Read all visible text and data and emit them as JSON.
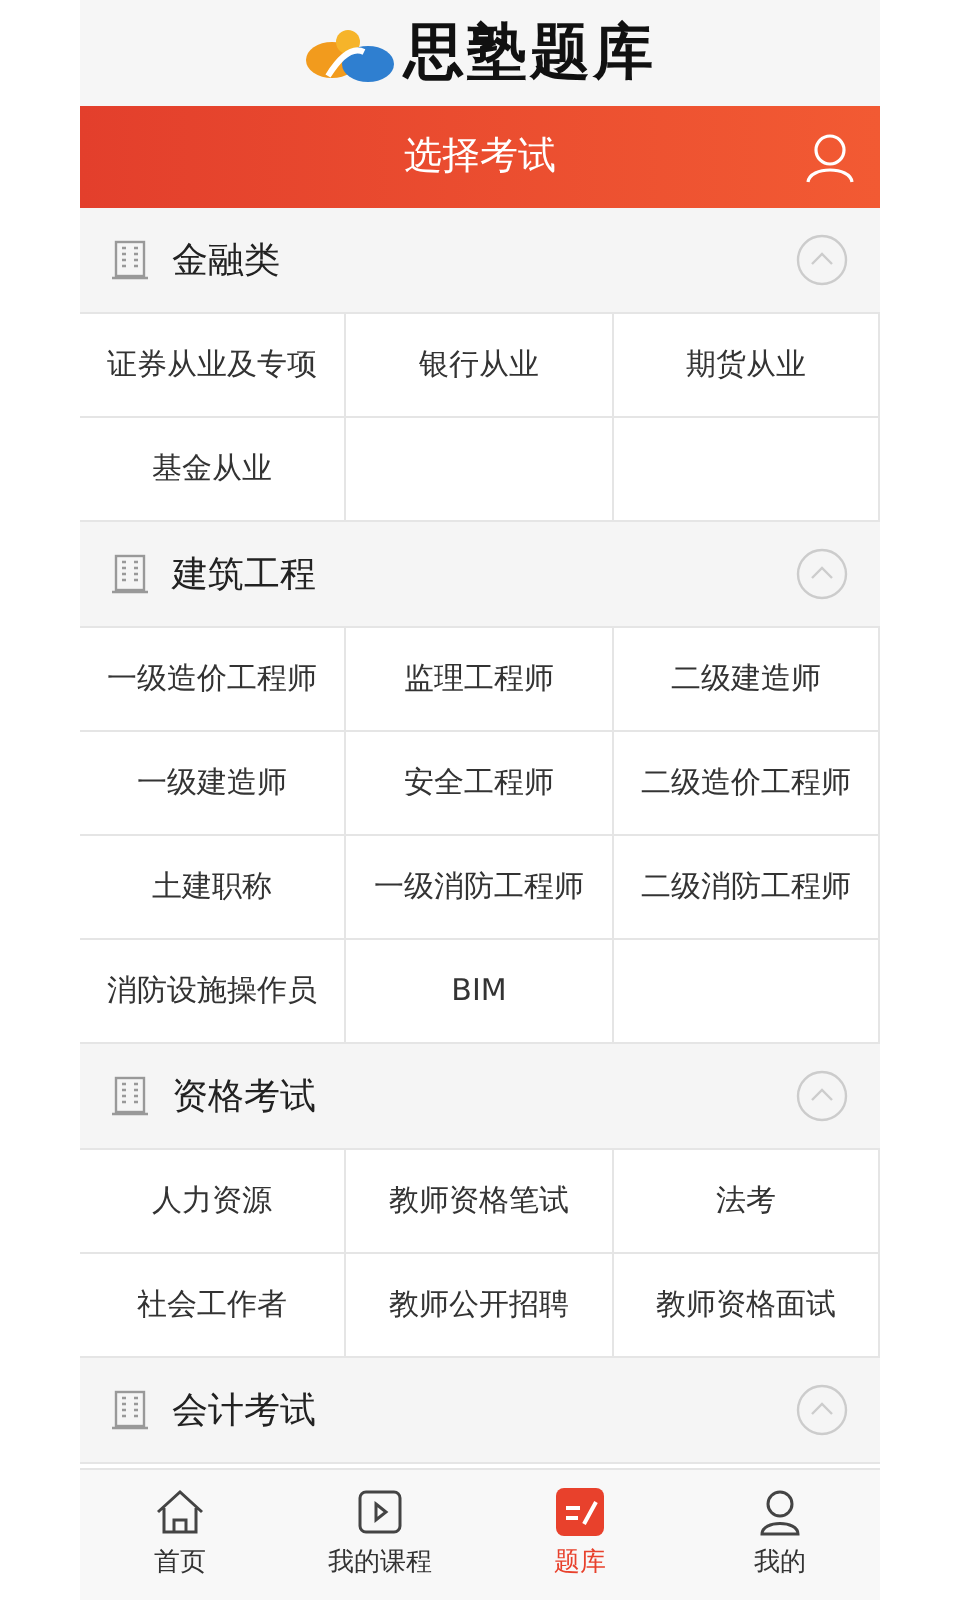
{
  "header": {
    "logo_text": "思塾题库"
  },
  "title_bar": {
    "title": "选择考试"
  },
  "sections": [
    {
      "title": "金融类",
      "expanded": true,
      "items": [
        "证券从业及专项",
        "银行从业",
        "期货从业",
        "基金从业"
      ]
    },
    {
      "title": "建筑工程",
      "expanded": true,
      "items": [
        "一级造价工程师",
        "监理工程师",
        "二级建造师",
        "一级建造师",
        "安全工程师",
        "二级造价工程师",
        "土建职称",
        "一级消防工程师",
        "二级消防工程师",
        "消防设施操作员",
        "BIM"
      ]
    },
    {
      "title": "资格考试",
      "expanded": true,
      "items": [
        "人力资源",
        "教师资格笔试",
        "法考",
        "社会工作者",
        "教师公开招聘",
        "教师资格面试"
      ]
    },
    {
      "title": "会计考试",
      "expanded": true
    }
  ],
  "bottom_nav": [
    {
      "kind": "home",
      "label": "首页",
      "selected": false
    },
    {
      "kind": "course",
      "label": "我的课程",
      "selected": false
    },
    {
      "kind": "bank",
      "label": "题库",
      "selected": true
    },
    {
      "kind": "me",
      "label": "我的",
      "selected": false
    }
  ]
}
